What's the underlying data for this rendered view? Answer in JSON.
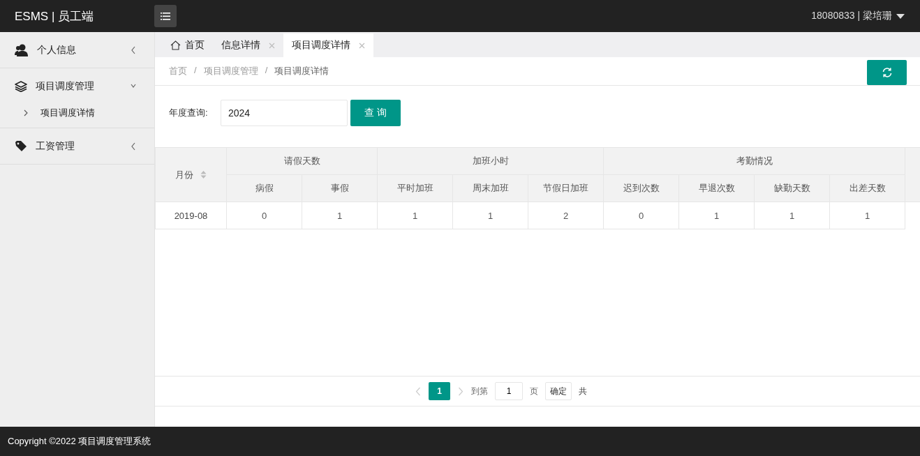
{
  "header": {
    "logo": "ESMS | 员工端",
    "user": "18080833 | 梁培珊"
  },
  "sidebar": {
    "items": [
      {
        "label": "个人信息",
        "expanded": false
      },
      {
        "label": "项目调度管理",
        "expanded": true,
        "children": [
          {
            "label": "项目调度详情"
          }
        ]
      },
      {
        "label": "工资管理",
        "expanded": false
      }
    ]
  },
  "tabs": [
    {
      "label": "首页",
      "kind": "home",
      "selected": false
    },
    {
      "label": "信息详情",
      "kind": "closable",
      "selected": false
    },
    {
      "label": "项目调度详情",
      "kind": "closable",
      "selected": true
    }
  ],
  "breadcrumb": {
    "separator": "/",
    "items": [
      "首页",
      "项目调度管理",
      "项目调度详情"
    ]
  },
  "search": {
    "label": "年度查询:",
    "value": "2024",
    "button": "查 询"
  },
  "table": {
    "month_header": "月份",
    "groups": [
      {
        "label": "请假天数",
        "columns": [
          "病假",
          "事假"
        ]
      },
      {
        "label": "加班小时",
        "columns": [
          "平时加班",
          "周末加班",
          "节假日加班"
        ]
      },
      {
        "label": "考勤情况",
        "columns": [
          "迟到次数",
          "早退次数",
          "缺勤天数",
          "出差天数"
        ]
      }
    ],
    "rows": [
      {
        "month": "2019-08",
        "cells": [
          "0",
          "1",
          "1",
          "1",
          "2",
          "0",
          "1",
          "1",
          "1"
        ]
      }
    ]
  },
  "pagination": {
    "pages": [
      {
        "label": "1",
        "selected": true
      }
    ],
    "goto_label": "到第",
    "goto_value": "1",
    "page_unit": "页",
    "confirm": "确定",
    "total_prefix": "共"
  },
  "footer": "Copyright ©2022 项目调度管理系统"
}
